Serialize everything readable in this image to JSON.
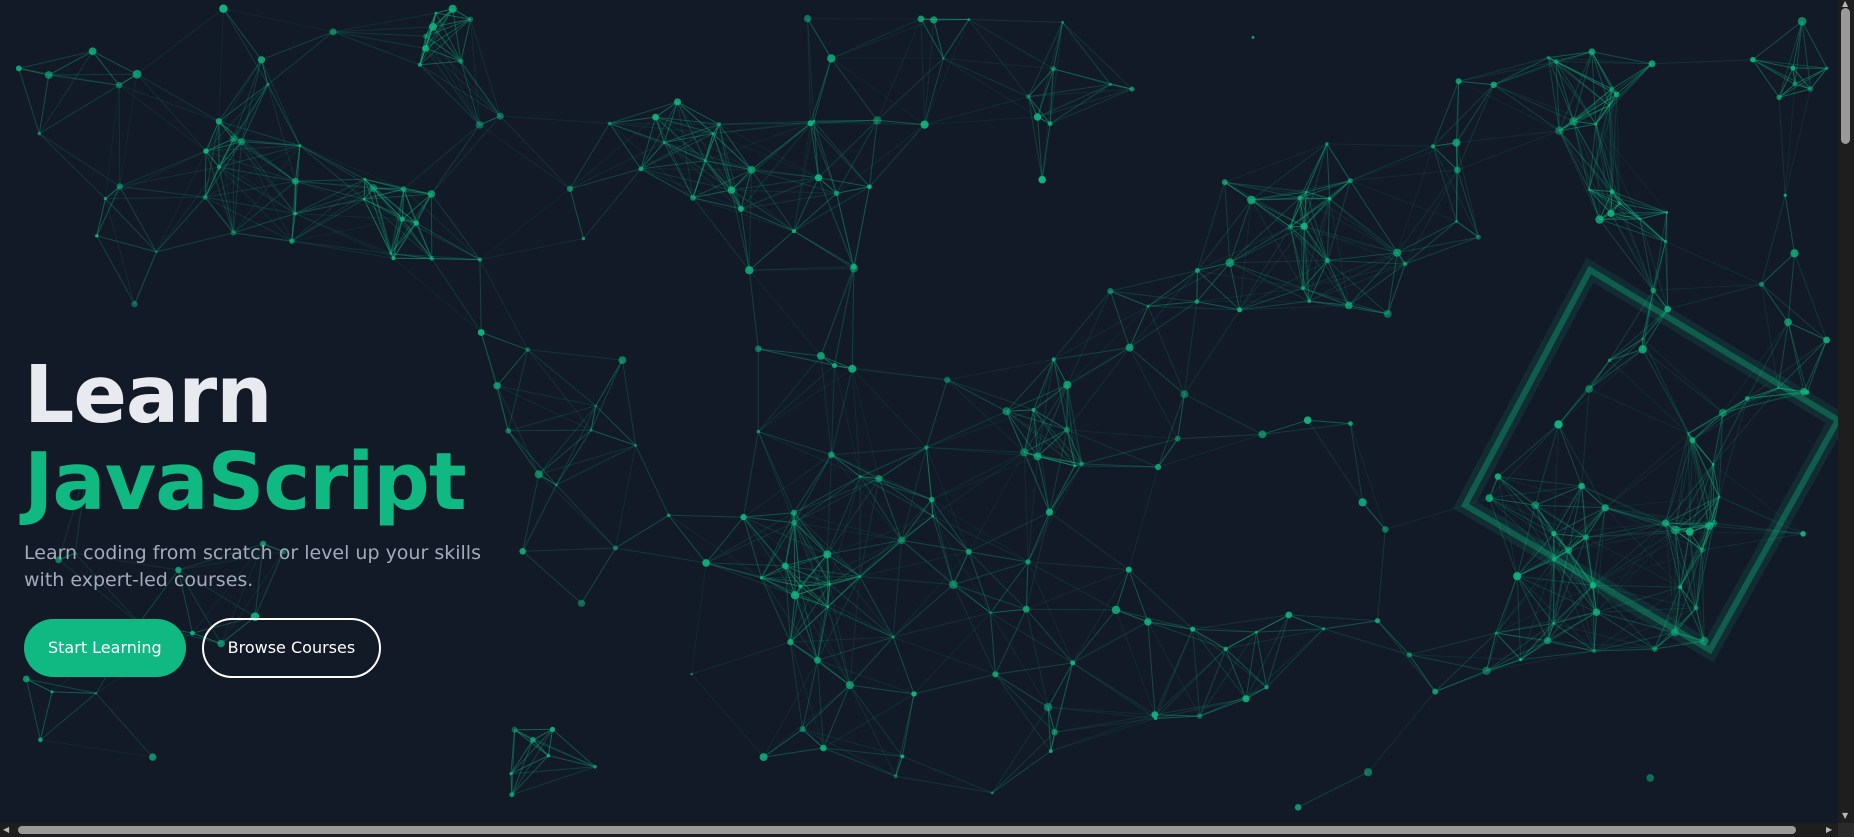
{
  "hero": {
    "title_main": "Learn ",
    "title_accent": "JavaScript",
    "subtitle": "Learn coding from scratch or level up your skills with expert-led courses.",
    "primary_button": "Start Learning",
    "secondary_button": "Browse Courses"
  },
  "scrollbar_arrows": {
    "up": "▲",
    "down": "▼",
    "left": "◀",
    "right": "▶"
  },
  "colors": {
    "background": "#121a28",
    "accent": "#10b981",
    "title": "#e8eaef",
    "subtitle": "#a3abbb"
  }
}
